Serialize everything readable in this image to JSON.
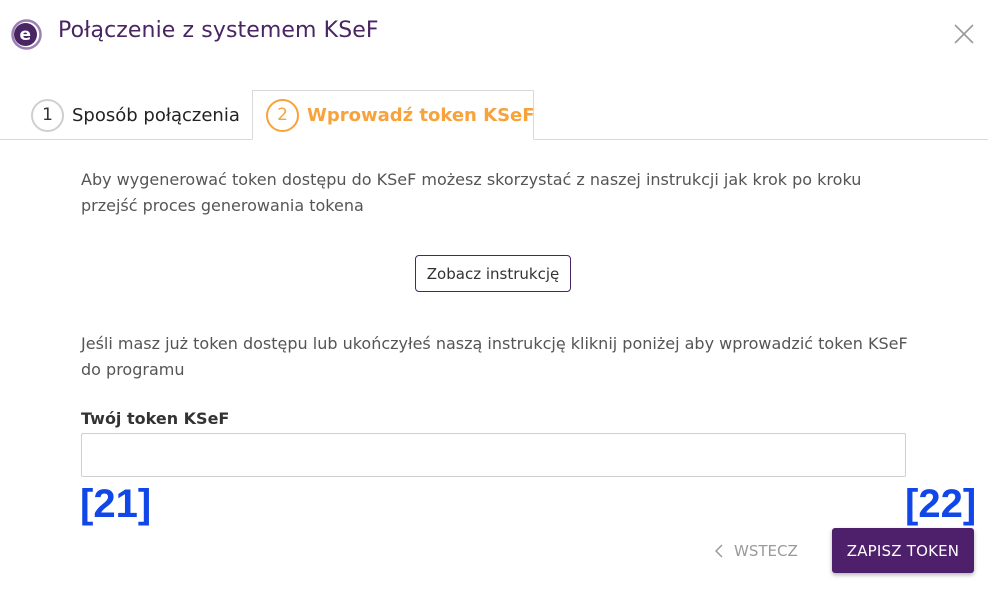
{
  "dialog": {
    "title": "Połączenie z systemem KSeF",
    "logo_letter": "e"
  },
  "tabs": [
    {
      "number": "1",
      "label": "Sposób połączenia",
      "active": false
    },
    {
      "number": "2",
      "label": "Wprowadź token KSeF",
      "active": true
    }
  ],
  "content": {
    "intro_text": "Aby wygenerować token dostępu do KSeF możesz skorzystać z naszej instrukcji jak krok po kroku przejść proces generowania tokena",
    "instruction_button": "Zobacz instrukcję",
    "info_text": "Jeśli masz już token dostępu lub ukończyłeś naszą instrukcję kliknij poniżej aby wprowadzić token KSeF do programu",
    "token_label": "Twój token KSeF",
    "token_value": "",
    "token_placeholder": ""
  },
  "markers": {
    "left": "[21]",
    "right": "[22]"
  },
  "footer": {
    "back_label": "WSTECZ",
    "save_label": "ZAPISZ TOKEN"
  },
  "colors": {
    "brand_purple": "#4a2563",
    "accent_orange": "#f7a23b",
    "primary_button": "#4e1f6b",
    "marker_blue": "#1146e8"
  },
  "icons": {
    "logo": "e-logo-icon",
    "close": "close-icon",
    "back": "chevron-left-icon"
  }
}
